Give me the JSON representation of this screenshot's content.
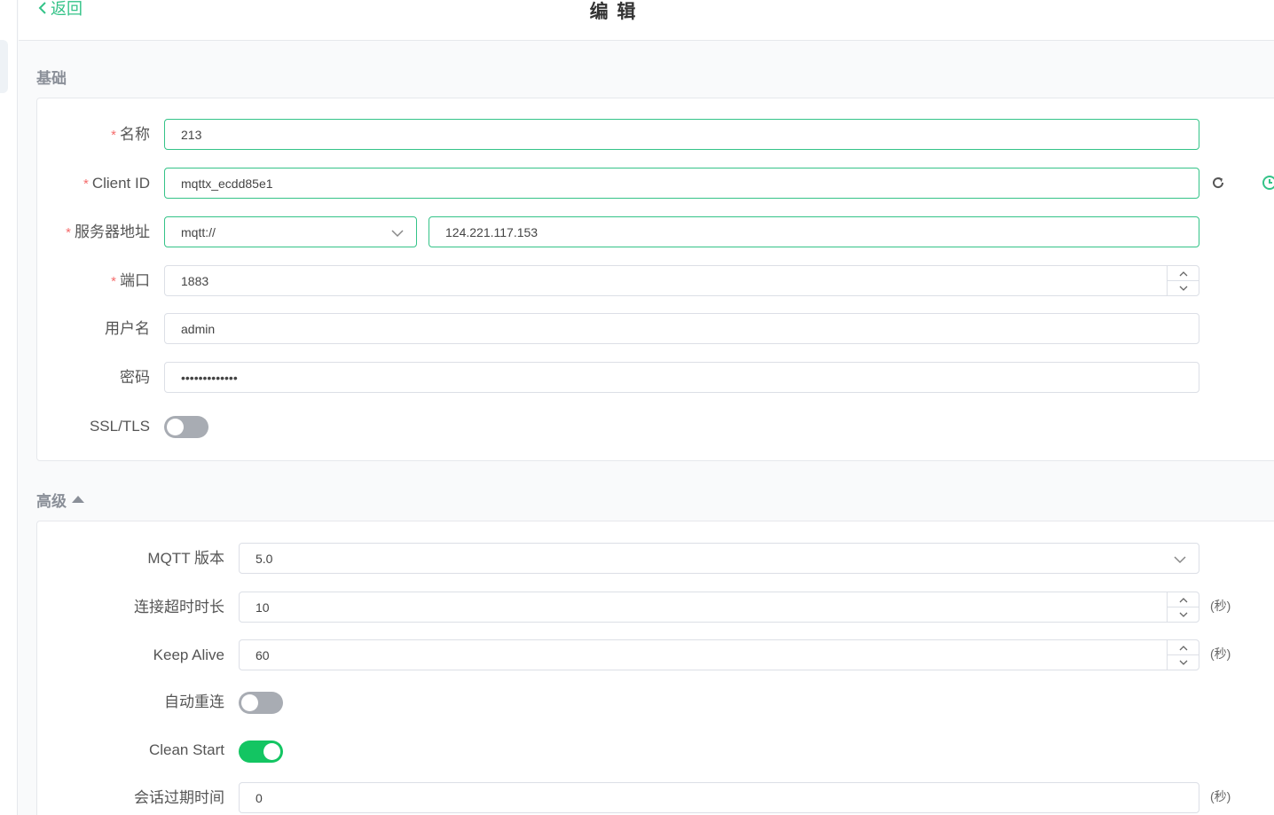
{
  "header": {
    "back_label": "返回",
    "title": "编 辑"
  },
  "basic": {
    "section_title": "基础",
    "name": {
      "label": "名称",
      "value": "213"
    },
    "client_id": {
      "label": "Client ID",
      "value": "mqttx_ecdd85e1"
    },
    "server": {
      "label": "服务器地址",
      "protocol": "mqtt://",
      "host": "124.221.117.153"
    },
    "port": {
      "label": "端口",
      "value": "1883"
    },
    "username": {
      "label": "用户名",
      "value": "admin"
    },
    "password": {
      "label": "密码",
      "value": "•••••••••••••"
    },
    "ssl": {
      "label": "SSL/TLS",
      "enabled": false
    }
  },
  "advanced": {
    "section_title": "高级",
    "mqtt_version": {
      "label": "MQTT 版本",
      "value": "5.0"
    },
    "connect_timeout": {
      "label": "连接超时时长",
      "value": "10",
      "unit": "(秒)"
    },
    "keep_alive": {
      "label": "Keep Alive",
      "value": "60",
      "unit": "(秒)"
    },
    "auto_reconnect": {
      "label": "自动重连",
      "enabled": false
    },
    "clean_start": {
      "label": "Clean Start",
      "enabled": true
    },
    "session_expiry": {
      "label": "会话过期时间",
      "value": "0",
      "unit": "(秒)"
    }
  },
  "colors": {
    "accent": "#34c388",
    "required": "#f56c6c",
    "toggle_on": "#13c562",
    "toggle_off": "#a8acb3"
  },
  "icons": {
    "back": "chevron-left-icon",
    "refresh": "refresh-icon",
    "history": "clock-icon",
    "select": "chevron-down-icon",
    "stepper_up": "chevron-up-icon",
    "stepper_down": "chevron-down-icon",
    "collapse": "caret-up-icon"
  }
}
